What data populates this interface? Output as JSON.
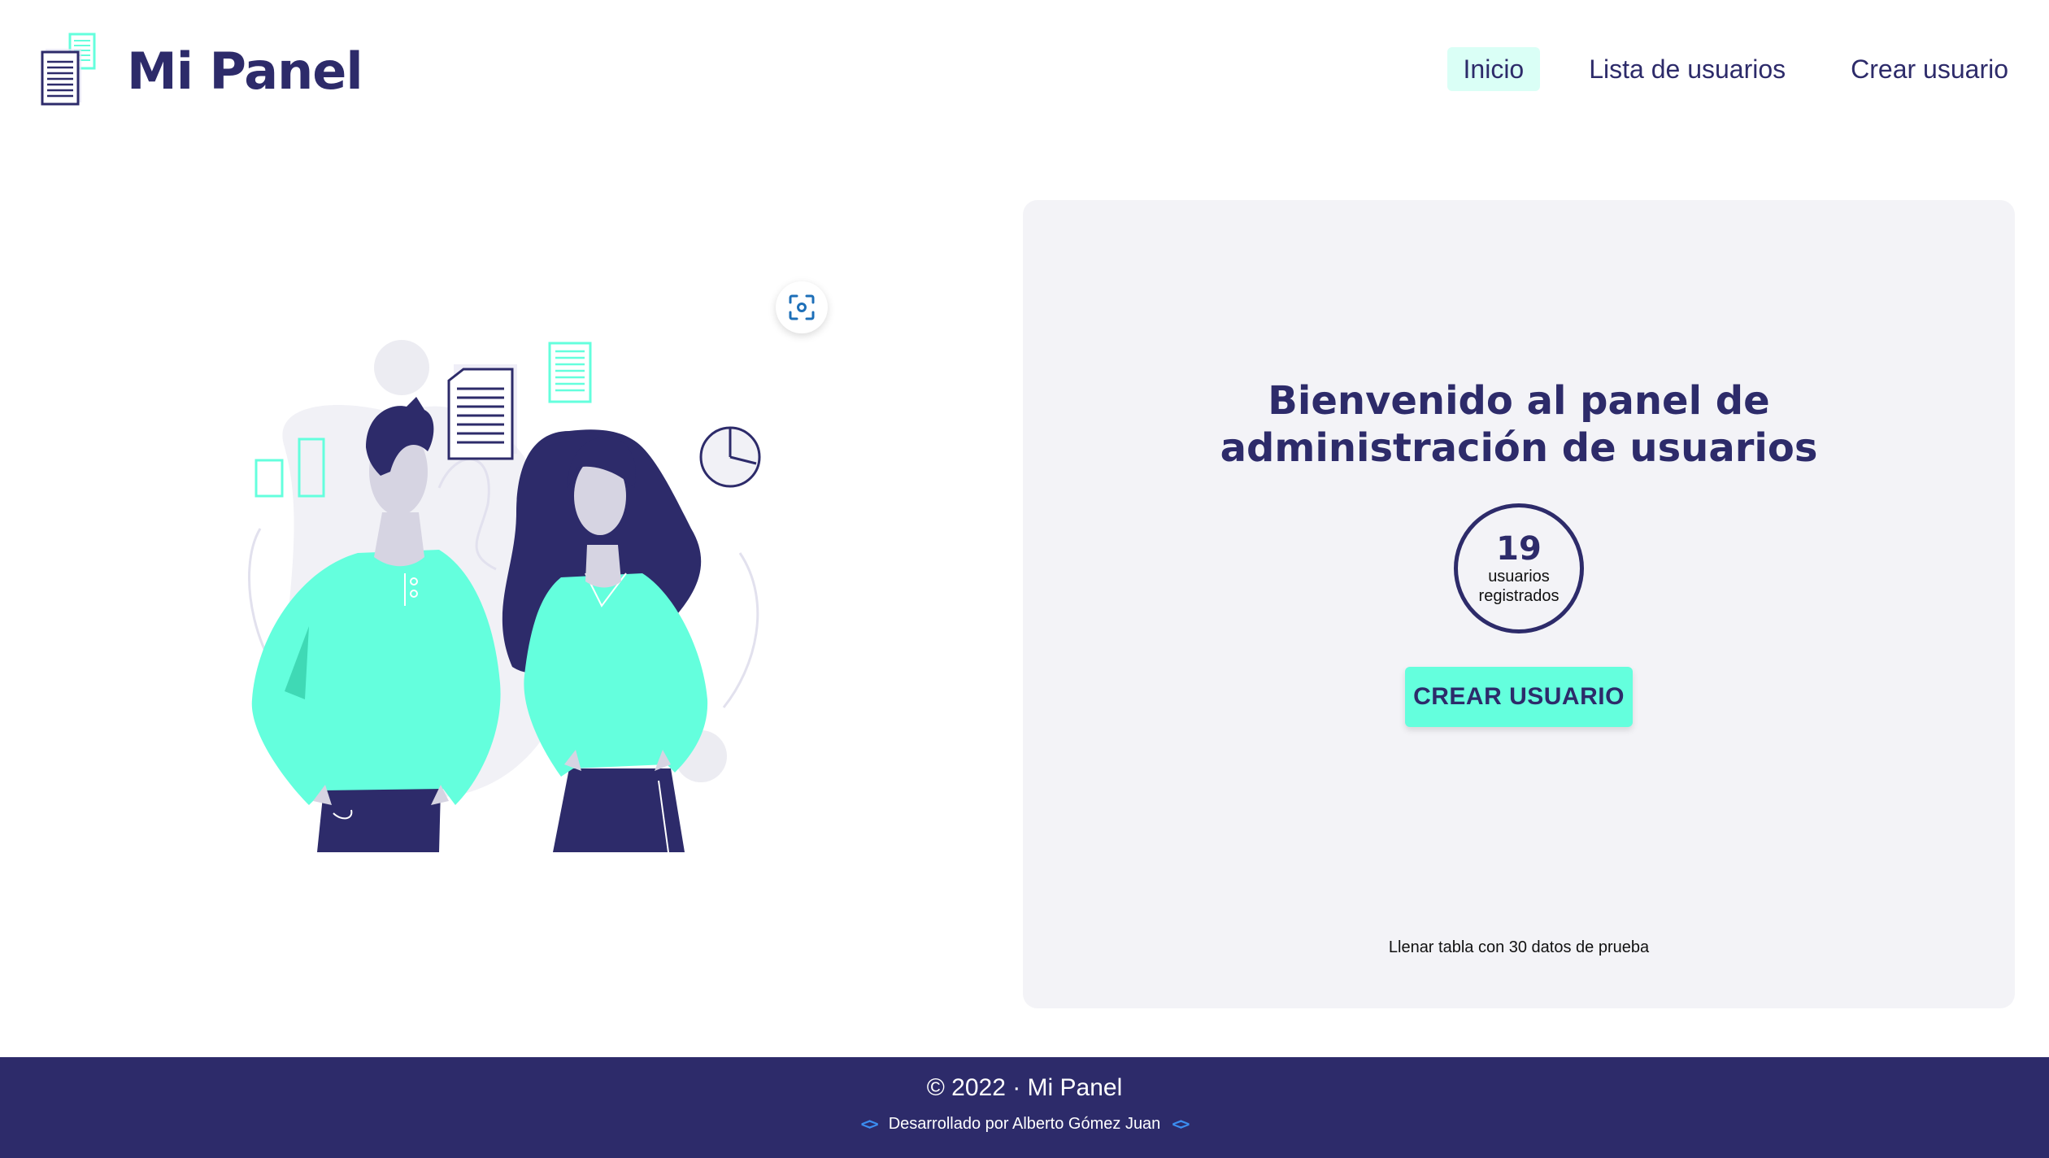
{
  "header": {
    "brand_title": "Mi Panel",
    "nav": [
      {
        "label": "Inicio",
        "active": true
      },
      {
        "label": "Lista de usuarios",
        "active": false
      },
      {
        "label": "Crear usuario",
        "active": false
      }
    ]
  },
  "illustration": {
    "icon": "people-with-documents-illustration",
    "scan_button_icon": "scan-icon"
  },
  "welcome": {
    "title_line1": "Bienvenido al panel de",
    "title_line2": "administración de usuarios"
  },
  "counter": {
    "value": "19",
    "label_line1": "usuarios",
    "label_line2": "registrados"
  },
  "create_button": {
    "label": "CREAR USUARIO"
  },
  "fill_link": {
    "label": "Llenar tabla con 30 datos de prueba"
  },
  "footer": {
    "copyright": "© 2022 · Mi Panel",
    "credits": "Desarrollado por Alberto Gómez Juan",
    "code_icon": "code-icon"
  },
  "colors": {
    "primary": "#2d2b6a",
    "accent": "#64ffdd",
    "nav_active_bg": "#dafff6",
    "card_bg": "#f3f3f7",
    "footer_link": "#3b8df0"
  }
}
